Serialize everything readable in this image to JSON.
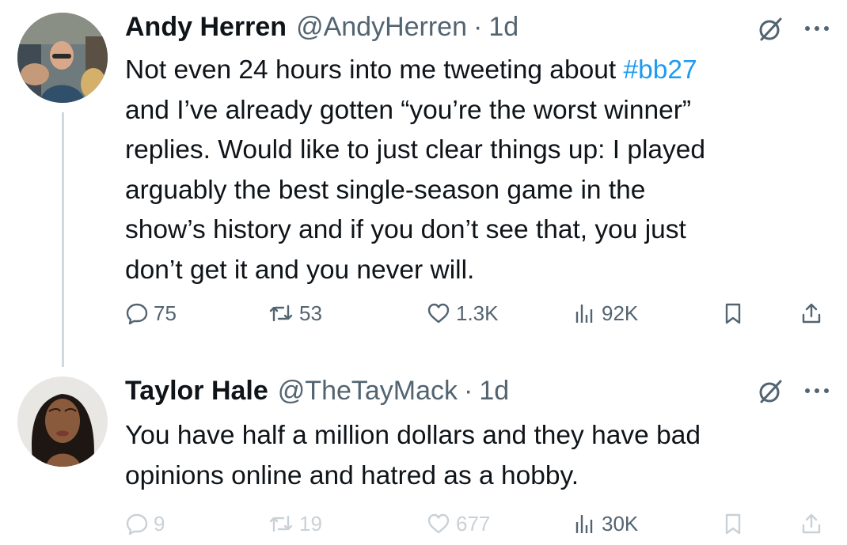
{
  "tweets": [
    {
      "display_name": "Andy Herren",
      "handle": "@AndyHerren",
      "separator": "·",
      "time": "1d",
      "text_before_hashtag": "Not even 24 hours into me tweeting about ",
      "hashtag": "#bb27",
      "text_after_hashtag": "\nand I’ve already gotten “you’re the worst winner”\nreplies. Would like to just clear things up: I played\narguably the best single-season game in the\nshow’s history and if you don’t see that, you just\ndon’t get it and you never will.",
      "avatar_icon": "profile-photo-man-glasses",
      "actions": {
        "replies": "75",
        "reposts": "53",
        "likes": "1.3K",
        "views": "92K"
      }
    },
    {
      "display_name": "Taylor Hale",
      "handle": "@TheTayMack",
      "separator": "·",
      "time": "1d",
      "text": "You have half a million dollars and they have bad\nopinions online and hatred as a hobby.",
      "avatar_icon": "profile-photo-woman",
      "actions": {
        "replies": "9",
        "reposts": "19",
        "likes": "677",
        "views": "30K"
      }
    }
  ],
  "icons": {
    "grok": "grok-icon",
    "more": "more-icon",
    "reply": "reply-icon",
    "repost": "repost-icon",
    "like": "like-icon",
    "views": "views-icon",
    "bookmark": "bookmark-icon",
    "share": "share-icon"
  },
  "colors": {
    "text": "#0f1419",
    "secondary": "#536471",
    "hashtag": "#1d9bf0",
    "faded": "#c9d1d7",
    "thread_line": "#cfd9de"
  }
}
